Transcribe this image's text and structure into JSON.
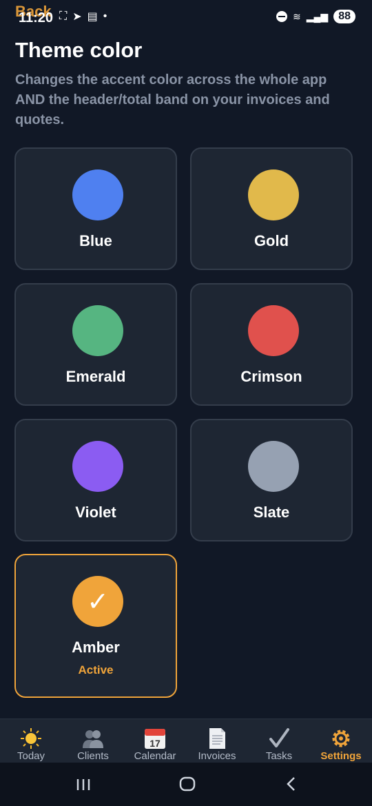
{
  "status_bar": {
    "back_label": "Back",
    "time": "11:20",
    "battery": "88"
  },
  "page": {
    "title": "Theme color",
    "description": "Changes the accent color across the whole app AND the header/total band on your invoices and quotes."
  },
  "themes": [
    {
      "label": "Blue",
      "color": "#4f80f0"
    },
    {
      "label": "Gold",
      "color": "#e1b94b"
    },
    {
      "label": "Emerald",
      "color": "#56b581"
    },
    {
      "label": "Crimson",
      "color": "#e0514d"
    },
    {
      "label": "Violet",
      "color": "#8b5cf2"
    },
    {
      "label": "Slate",
      "color": "#96a1b2"
    },
    {
      "label": "Amber",
      "color": "#f0a43a",
      "status": "Active",
      "check": "✓"
    }
  ],
  "nav": {
    "items": [
      {
        "label": "Today",
        "icon": "sun-icon"
      },
      {
        "label": "Clients",
        "icon": "people-icon"
      },
      {
        "label": "Calendar",
        "icon": "calendar-icon",
        "icon_text": "17"
      },
      {
        "label": "Invoices",
        "icon": "document-icon"
      },
      {
        "label": "Tasks",
        "icon": "checkmark-icon"
      },
      {
        "label": "Settings",
        "icon": "gear-icon",
        "active": true
      }
    ]
  },
  "colors": {
    "accent": "#f0a43a",
    "background": "#111826",
    "card": "#1e2633"
  }
}
